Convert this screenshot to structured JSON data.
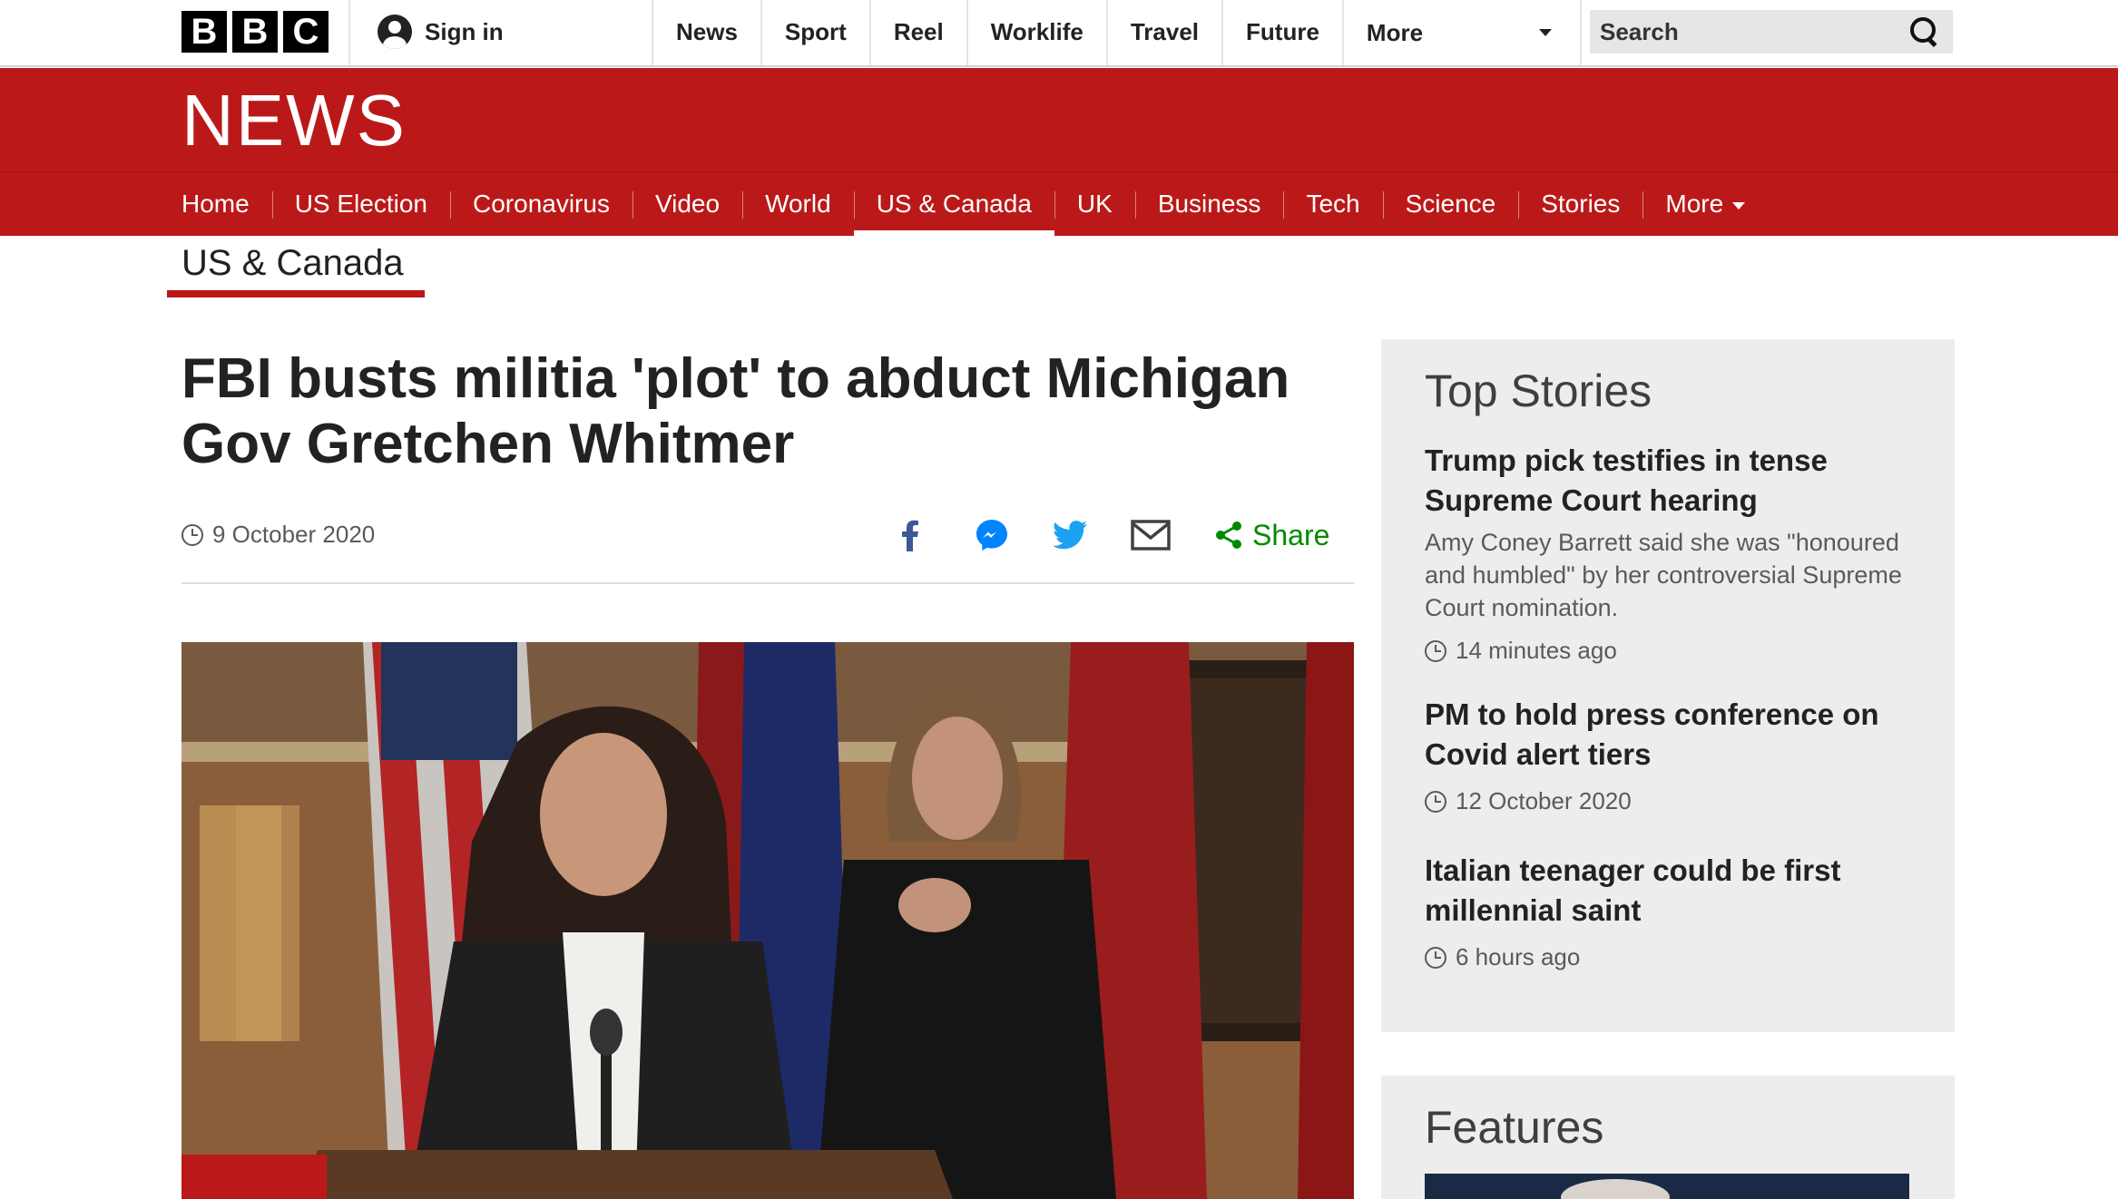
{
  "bbc_bar": {
    "logo_letters": [
      "B",
      "B",
      "C"
    ],
    "sign_in": "Sign in",
    "nav": [
      "News",
      "Sport",
      "Reel",
      "Worklife",
      "Travel",
      "Future"
    ],
    "more": "More",
    "search_placeholder": "Search"
  },
  "masthead": {
    "title": "NEWS"
  },
  "news_nav": {
    "items": [
      "Home",
      "US Election",
      "Coronavirus",
      "Video",
      "World",
      "US & Canada",
      "UK",
      "Business",
      "Tech",
      "Science",
      "Stories"
    ],
    "more": "More",
    "active": "US & Canada"
  },
  "section": {
    "title": "US & Canada"
  },
  "article": {
    "headline": "FBI busts militia 'plot' to abduct Michigan Gov Gretchen Whitmer",
    "date": "9 October 2020",
    "share_label": "Share",
    "share_icons": [
      "facebook-icon",
      "messenger-icon",
      "twitter-icon",
      "email-icon",
      "share-icon"
    ]
  },
  "top_stories": {
    "title": "Top Stories",
    "items": [
      {
        "headline": "Trump pick testifies in tense Supreme Court hearing",
        "summary": "Amy Coney Barrett said she was \"honoured and humbled\" by her controversial Supreme Court nomination.",
        "time": "14 minutes ago"
      },
      {
        "headline": "PM to hold press conference on Covid alert tiers",
        "summary": "",
        "time": "12 October 2020"
      },
      {
        "headline": "Italian teenager could be first millennial saint",
        "summary": "",
        "time": "6 hours ago"
      }
    ]
  },
  "features": {
    "title": "Features"
  },
  "colors": {
    "brand_red": "#bb1919",
    "share_green": "#008a00",
    "facebook": "#3b5998",
    "messenger": "#0084ff",
    "twitter": "#1da1f2"
  }
}
